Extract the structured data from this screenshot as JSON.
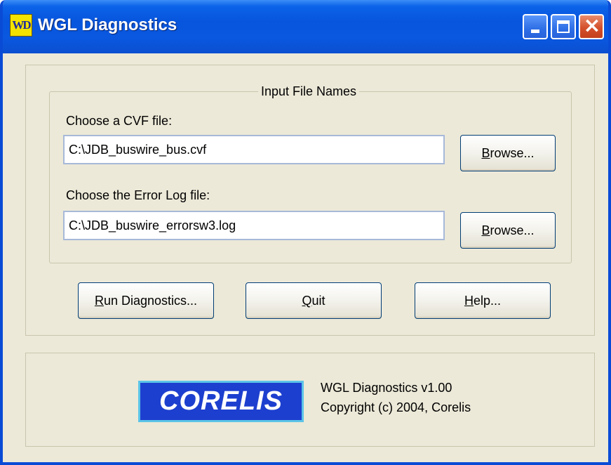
{
  "window": {
    "title": "WGL Diagnostics",
    "icon_letters": "WD"
  },
  "input_group": {
    "legend": "Input File Names",
    "cvf_label": "Choose a CVF file:",
    "cvf_value": "C:\\JDB_buswire_bus.cvf",
    "log_label": "Choose the Error Log file:",
    "log_value": "C:\\JDB_buswire_errorsw3.log",
    "browse_prefix": "B",
    "browse_rest": "rowse..."
  },
  "buttons": {
    "run_mnemonic": "R",
    "run_rest": "un Diagnostics...",
    "quit_mnemonic": "Q",
    "quit_rest": "uit",
    "help_mnemonic": "H",
    "help_rest": "elp..."
  },
  "about": {
    "logo_text": "CORELIS",
    "version": "WGL Diagnostics v1.00",
    "copyright": "Copyright (c) 2004, Corelis"
  },
  "colors": {
    "titlebar": "#0855dd",
    "window_bg": "#ece9d8",
    "logo_bg": "#1d3fcf",
    "logo_border": "#5cc4e8"
  }
}
